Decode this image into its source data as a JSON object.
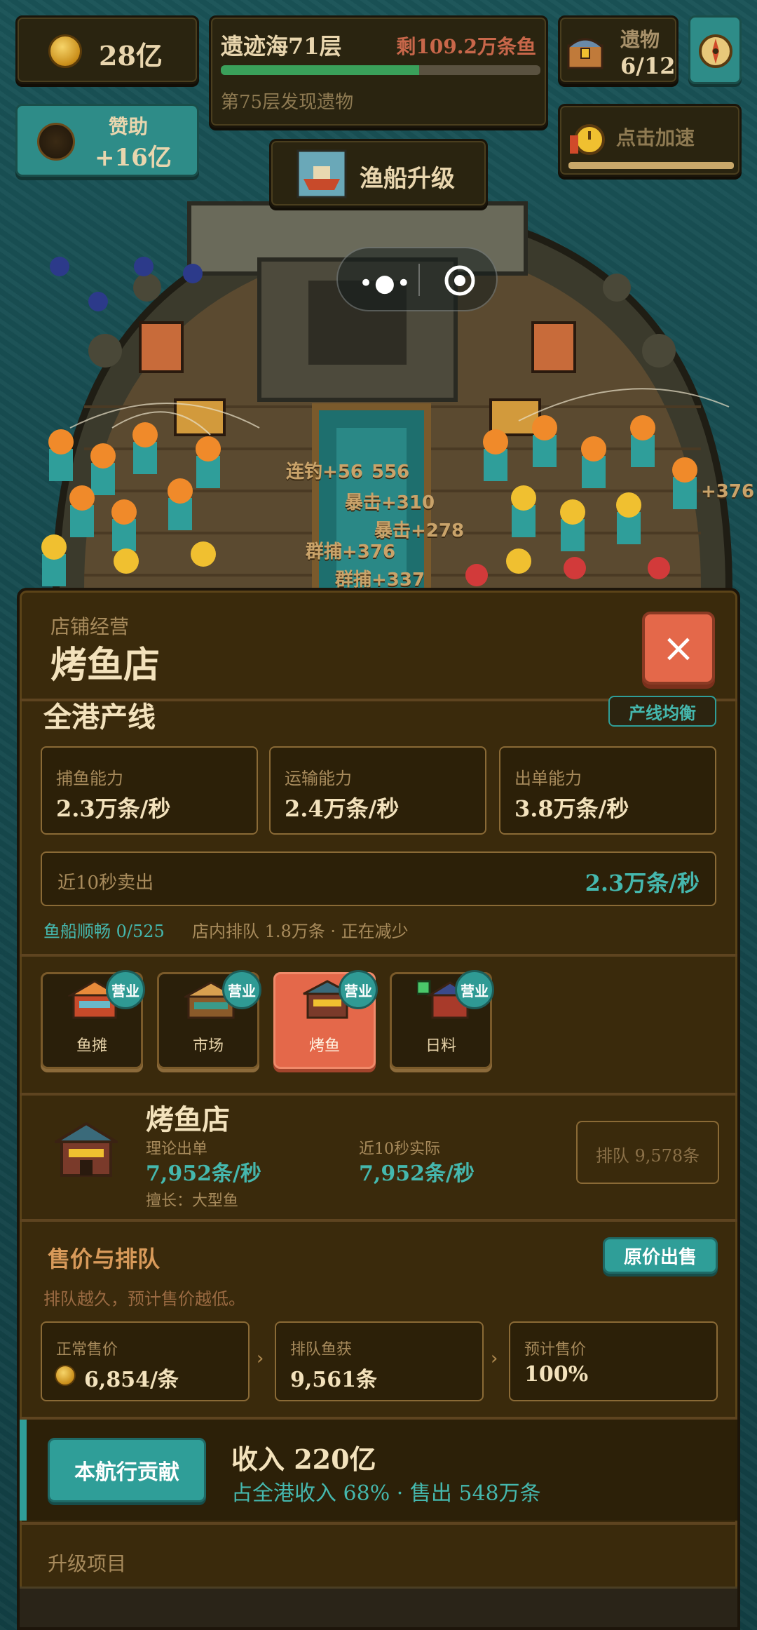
{
  "hud": {
    "coins": "28亿",
    "ruins": {
      "title": "遗迹海71层",
      "remaining": "剩109.2万条鱼",
      "subtitle": "第75层发现遗物",
      "progress": 0.62
    },
    "relics": {
      "label": "遗物",
      "count": "6/12"
    },
    "sponsor": {
      "label": "赞助",
      "value": "+16亿"
    },
    "speedup": {
      "label": "点击加速"
    },
    "upgrade_ship": {
      "label": "渔船升级"
    }
  },
  "scene_labels": [
    "连钓+56",
    "556",
    "暴击+310",
    "暴击+278",
    "群捕+376",
    "群捕+337",
    "+376"
  ],
  "panel": {
    "eyebrow": "店铺经营",
    "title": "烤鱼店",
    "close_symbol": "×",
    "port_line": {
      "heading": "全港产线",
      "balance_button": "产线均衡",
      "capacities": [
        {
          "label": "捕鱼能力",
          "value": "2.3万条/秒"
        },
        {
          "label": "运输能力",
          "value": "2.4万条/秒"
        },
        {
          "label": "出单能力",
          "value": "3.8万条/秒"
        }
      ],
      "recent_sales": {
        "label": "近10秒卖出",
        "value": "2.3万条/秒"
      },
      "status_boat": "鱼船顺畅 0/525",
      "status_queue": "店内排队 1.8万条 · 正在减少"
    },
    "shops": [
      {
        "name": "鱼摊",
        "badge": "营业",
        "active": false
      },
      {
        "name": "市场",
        "badge": "营业",
        "active": false
      },
      {
        "name": "烤鱼",
        "badge": "营业",
        "active": true
      },
      {
        "name": "日料",
        "badge": "营业",
        "active": false
      }
    ],
    "shop_detail": {
      "name": "烤鱼店",
      "theoretical_label": "理论出单",
      "theoretical_value": "7,952条/秒",
      "actual_label": "近10秒实际",
      "actual_value": "7,952条/秒",
      "specialty": "擅长：大型鱼",
      "queue_badge": "排队 9,578条"
    },
    "pricing": {
      "heading": "售价与排队",
      "button": "原价出售",
      "note": "排队越久，预计售价越低。",
      "cards": [
        {
          "label": "正常售价",
          "value": "6,854/条"
        },
        {
          "label": "排队鱼获",
          "value": "9,561条"
        },
        {
          "label": "预计售价",
          "value": "100%"
        }
      ],
      "arrow": "›"
    },
    "contribution": {
      "button": "本航行贡献",
      "income": "收入 220亿",
      "detail": "占全港收入 68% · 售出 548万条"
    },
    "upgrade_heading": "升级项目"
  },
  "colors": {
    "teal": "#45b8ae",
    "close_red": "#e4684a",
    "active_tile": "#e4684a",
    "progress_green": "#3aa05a"
  }
}
